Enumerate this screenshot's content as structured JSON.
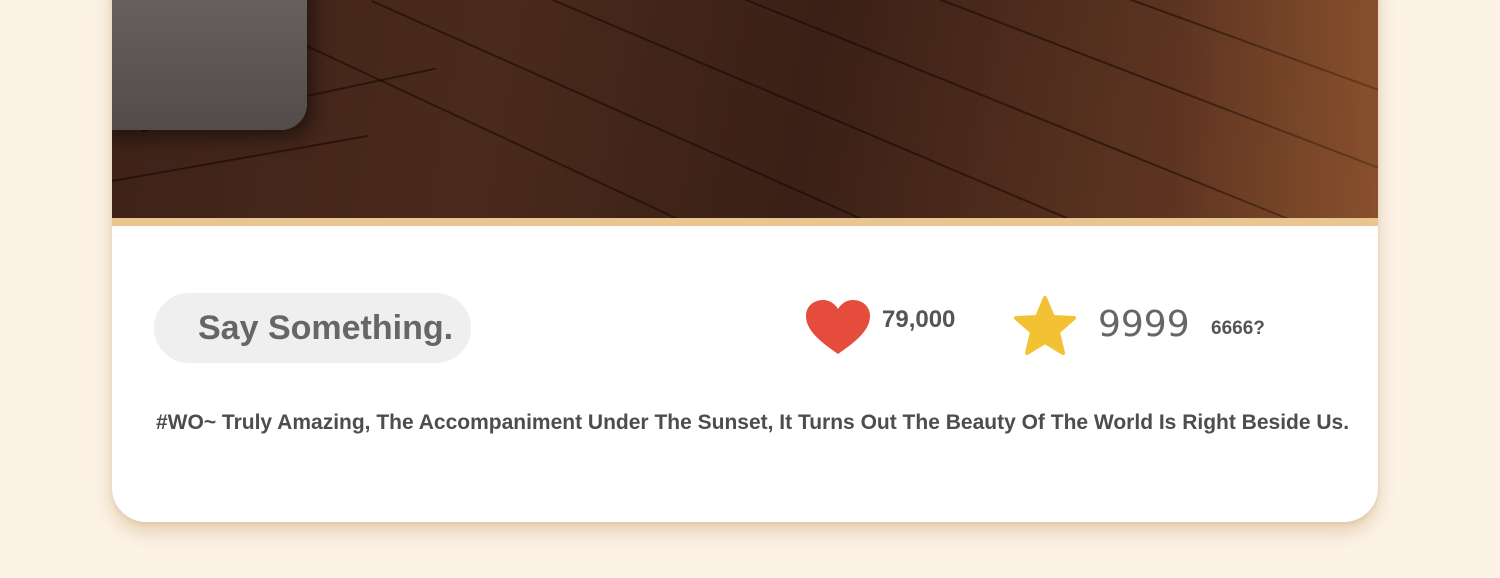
{
  "post": {
    "comment_placeholder": "Say Something.",
    "likes_count": "79,000",
    "favorites_count": "9999",
    "extra_count": "6666?",
    "caption": "#WO~ Truly Amazing, The Accompaniment Under The Sunset, It Turns Out The Beauty Of The World Is Right Beside Us."
  },
  "icons": {
    "like": "heart-icon",
    "favorite": "star-icon"
  },
  "colors": {
    "background": "#fcf2e6",
    "divider": "#e9c690",
    "heart": "#e54c3c",
    "star": "#f3c234"
  }
}
